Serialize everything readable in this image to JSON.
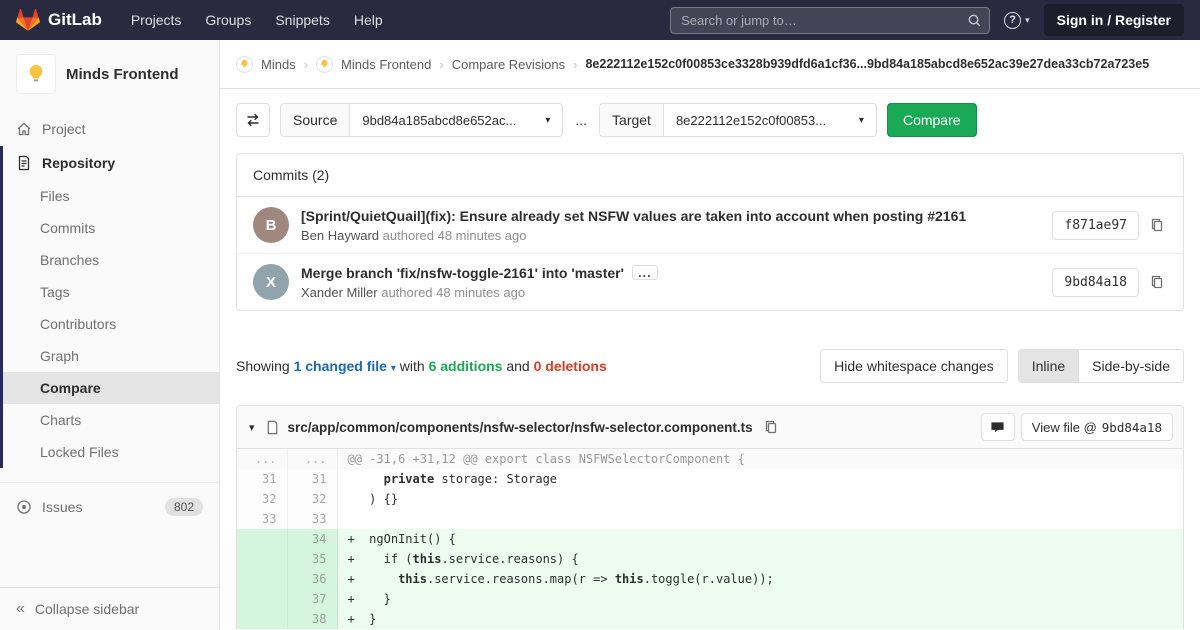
{
  "colors": {
    "navbar_bg": "#29293f",
    "brand_orange": "#e24329",
    "accent_indigo": "#292961",
    "success_green": "#1aaa55",
    "danger_red": "#db3b21",
    "link_blue": "#1b69b6",
    "added_line_bg": "#ecfdf0"
  },
  "icons": {
    "chevron_down": "▾",
    "breadcrumb_separator": "›",
    "help": "?",
    "collapse": "«",
    "ellipsis": "..."
  },
  "navbar": {
    "logo_text": "GitLab",
    "menu": [
      "Projects",
      "Groups",
      "Snippets",
      "Help"
    ],
    "search": {
      "placeholder": "Search or jump to…"
    },
    "sign_in_label": "Sign in / Register"
  },
  "sidebar": {
    "project_name": "Minds Frontend",
    "project_item": "Project",
    "repository_item": "Repository",
    "repo_subitems": [
      "Files",
      "Commits",
      "Branches",
      "Tags",
      "Contributors",
      "Graph",
      "Compare",
      "Charts",
      "Locked Files"
    ],
    "active_subitem": "Compare",
    "issues_label": "Issues",
    "issues_count": "802",
    "collapse_label": "Collapse sidebar"
  },
  "breadcrumb": {
    "group": "Minds",
    "project": "Minds Frontend",
    "section": "Compare Revisions",
    "current": "8e222112e152c0f00853ce3328b939dfd6a1cf36...9bd84a185abcd8e652ac39e27dea33cb72a723e5"
  },
  "compare_form": {
    "source_label": "Source",
    "source_value": "9bd84a185abcd8e652ac...",
    "separator": "...",
    "target_label": "Target",
    "target_value": "8e222112e152c0f00853...",
    "compare_button": "Compare"
  },
  "commits": {
    "header": "Commits (2)",
    "list": [
      {
        "title": "[Sprint/QuietQuail](fix): Ensure already set NSFW values are taken into account when posting #2161",
        "author": "Ben Hayward",
        "meta": "authored 48 minutes ago",
        "sha": "f871ae97",
        "initial": "B"
      },
      {
        "title": "Merge branch 'fix/nsfw-toggle-2161' into 'master'",
        "author": "Xander Miller",
        "meta": "authored 48 minutes ago",
        "sha": "9bd84a18",
        "initial": "X"
      }
    ]
  },
  "summary": {
    "showing_label": "Showing",
    "changed_files": "1 changed file",
    "with_label": "with",
    "additions": "6 additions",
    "and_label": "and",
    "deletions": "0 deletions",
    "hide_whitespace": "Hide whitespace changes",
    "inline": "Inline",
    "side_by_side": "Side-by-side"
  },
  "diff": {
    "file_path": "src/app/common/components/nsfw-selector/nsfw-selector.component.ts",
    "view_file_label": "View file @",
    "view_file_sha": "9bd84a18",
    "lines": [
      {
        "old": "...",
        "new": "...",
        "type": "hunk",
        "content": [
          {
            "t": "@@ -31,6 +31,12 @@ export class NSFWSelectorComponent {"
          }
        ]
      },
      {
        "old": "31",
        "new": "31",
        "type": "context",
        "content": [
          {
            "t": "     "
          },
          {
            "t": "private",
            "b": true
          },
          {
            "t": " storage: Storage"
          }
        ]
      },
      {
        "old": "32",
        "new": "32",
        "type": "context",
        "content": [
          {
            "t": "   ) {}"
          }
        ]
      },
      {
        "old": "33",
        "new": "33",
        "type": "context",
        "content": [
          {
            "t": ""
          }
        ]
      },
      {
        "old": "",
        "new": "34",
        "type": "add",
        "content": [
          {
            "t": "+  ngOnInit() {"
          }
        ]
      },
      {
        "old": "",
        "new": "35",
        "type": "add",
        "content": [
          {
            "t": "+    if ("
          },
          {
            "t": "this",
            "b": true
          },
          {
            "t": ".service.reasons) {"
          }
        ]
      },
      {
        "old": "",
        "new": "36",
        "type": "add",
        "content": [
          {
            "t": "+      "
          },
          {
            "t": "this",
            "b": true
          },
          {
            "t": ".service.reasons.map(r => "
          },
          {
            "t": "this",
            "b": true
          },
          {
            "t": ".toggle(r.value));"
          }
        ]
      },
      {
        "old": "",
        "new": "37",
        "type": "add",
        "content": [
          {
            "t": "+    }"
          }
        ]
      },
      {
        "old": "",
        "new": "38",
        "type": "add",
        "content": [
          {
            "t": "+  }"
          }
        ]
      }
    ]
  }
}
